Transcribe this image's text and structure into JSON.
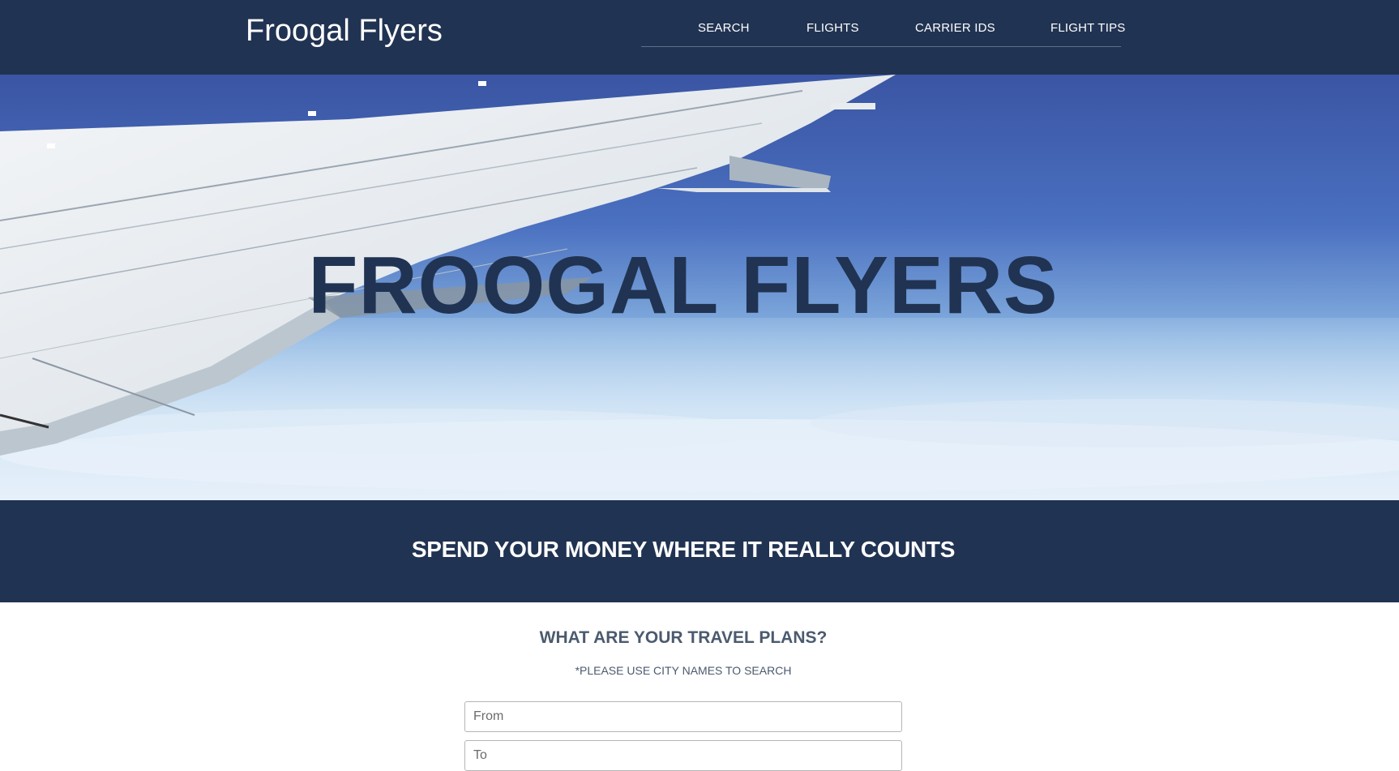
{
  "header": {
    "brand": "Froogal Flyers",
    "nav": [
      {
        "label": "SEARCH"
      },
      {
        "label": "FLIGHTS"
      },
      {
        "label": "CARRIER IDS"
      },
      {
        "label": "FLIGHT TIPS"
      }
    ]
  },
  "hero": {
    "title": "FROOGAL FLYERS",
    "image": "airplane-wing-over-clouds"
  },
  "tagline": "SPEND YOUR MONEY WHERE IT REALLY COUNTS",
  "search": {
    "heading": "WHAT ARE YOUR TRAVEL PLANS?",
    "note": "*PLEASE USE CITY NAMES TO SEARCH",
    "from_placeholder": "From",
    "to_placeholder": "To"
  },
  "colors": {
    "navy": "#213352",
    "white": "#ffffff",
    "muted_text": "#4b5a6e",
    "sky": "#4a6fbf"
  }
}
